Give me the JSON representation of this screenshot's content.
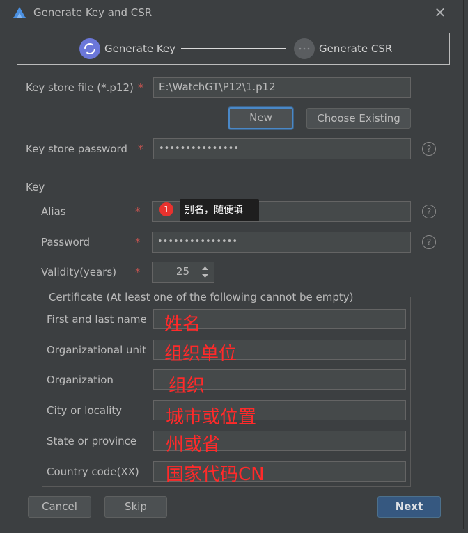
{
  "window": {
    "title": "Generate Key and CSR"
  },
  "steps": [
    {
      "label": "Generate Key"
    },
    {
      "label": "Generate CSR"
    }
  ],
  "keystore": {
    "file_label": "Key store file (*.p12)",
    "file_value": "E:\\WatchGT\\P12\\1.p12",
    "new_label": "New",
    "choose_label": "Choose Existing",
    "password_label": "Key store password",
    "password_value": "•••••••••••••••"
  },
  "key": {
    "section_label": "Key",
    "alias_label": "Alias",
    "alias_value": "",
    "password_label": "Password",
    "password_value": "•••••••••••••••",
    "validity_label": "Validity(years)",
    "validity_value": "25"
  },
  "tooltip": {
    "badge": "1",
    "text": "别名，随便填"
  },
  "required_mark": "*",
  "help_mark": "?",
  "certificate": {
    "legend": "Certificate (At least one of the following cannot be empty)",
    "fields": [
      {
        "label": "First and last name",
        "annotation": "姓名"
      },
      {
        "label": "Organizational unit",
        "annotation": "组织单位"
      },
      {
        "label": "Organization",
        "annotation": "组织"
      },
      {
        "label": "City or locality",
        "annotation": "城市或位置"
      },
      {
        "label": "State or province",
        "annotation": "州或省"
      },
      {
        "label": "Country code(XX)",
        "annotation": "国家代码CN"
      }
    ]
  },
  "footer": {
    "cancel_label": "Cancel",
    "skip_label": "Skip",
    "next_label": "Next"
  },
  "colors": {
    "background": "#3c3f41",
    "accent": "#365880",
    "required": "#c75450",
    "annotation": "#ff2a2a"
  }
}
